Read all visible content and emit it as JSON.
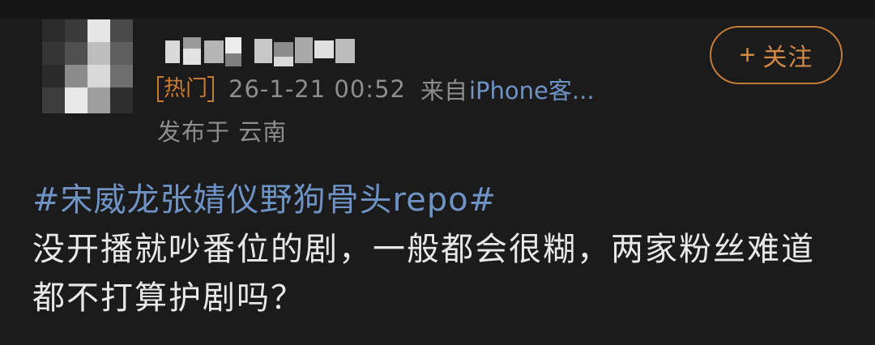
{
  "post": {
    "badge": "热门",
    "timestamp": "26-1-21 00:52",
    "source_prefix": "来自",
    "source_link": "iPhone客...",
    "location": "发布于 云南",
    "topic": "#宋威龙张婧仪野狗骨头repo#",
    "body": "没开播就吵番位的剧，一般都会很糊，两家粉丝难道都不打算护剧吗？"
  },
  "follow_button": {
    "plus": "+",
    "label": "关注"
  },
  "colors": {
    "background": "#1b1b1b",
    "accent_orange": "#c97a34",
    "link_blue": "#6f93c4",
    "meta_gray": "#8e8e8e",
    "body_text": "#e8e8e8"
  }
}
